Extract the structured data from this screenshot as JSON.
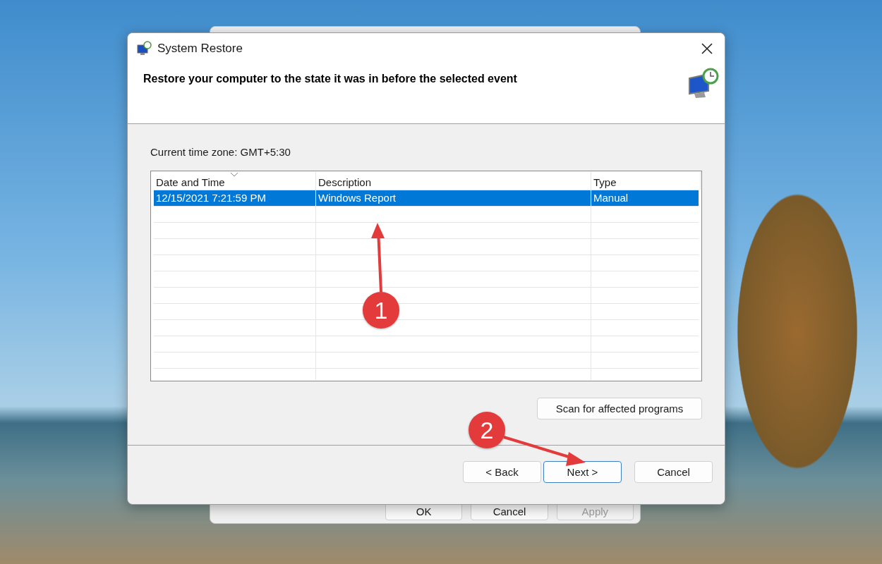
{
  "window": {
    "title": "System Restore",
    "heading": "Restore your computer to the state it was in before the selected event"
  },
  "time_zone": "Current time zone: GMT+5:30",
  "table": {
    "columns": [
      {
        "label": "Date and Time",
        "sorted": true
      },
      {
        "label": "Description",
        "sorted": false
      },
      {
        "label": "Type",
        "sorted": false
      }
    ],
    "rows": [
      {
        "cells": [
          "12/15/2021 7:21:59 PM",
          "Windows Report",
          "Manual"
        ],
        "selected": true
      }
    ]
  },
  "scan_button": "Scan for affected programs",
  "buttons": [
    {
      "label": "< Back",
      "default": false
    },
    {
      "label": "Next >",
      "default": true
    },
    {
      "label": "Cancel",
      "default": false
    }
  ],
  "background_window": {
    "buttons": [
      {
        "label": "OK",
        "disabled": false
      },
      {
        "label": "Cancel",
        "disabled": false
      },
      {
        "label": "Apply",
        "disabled": true
      }
    ]
  },
  "annotations": [
    {
      "number": "1"
    },
    {
      "number": "2"
    }
  ]
}
